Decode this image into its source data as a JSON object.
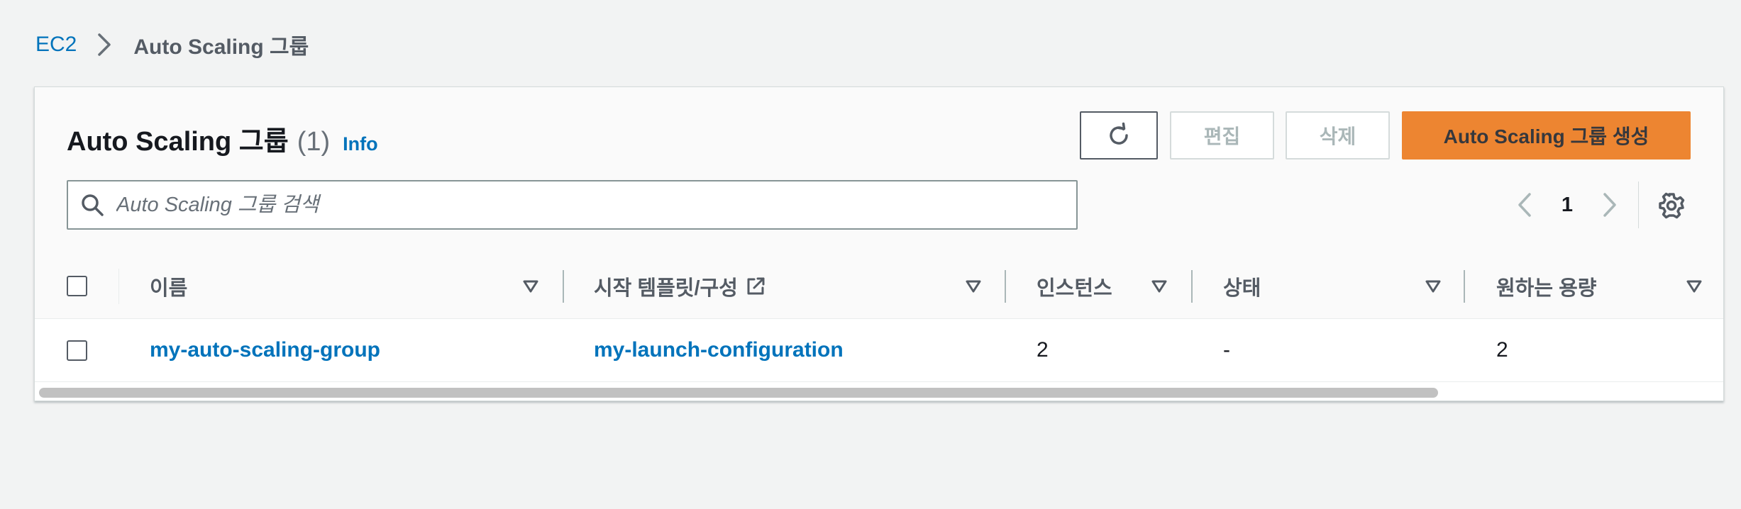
{
  "breadcrumb": {
    "root": "EC2",
    "current": "Auto Scaling 그룹"
  },
  "panel": {
    "title": "Auto Scaling 그룹",
    "count": "(1)",
    "info": "Info"
  },
  "toolbar": {
    "edit_label": "편집",
    "delete_label": "삭제",
    "create_label": "Auto Scaling 그룹 생성",
    "refresh_icon": "refresh-icon"
  },
  "search": {
    "placeholder": "Auto Scaling 그룹 검색",
    "value": ""
  },
  "pagination": {
    "current_page": "1"
  },
  "table": {
    "columns": [
      {
        "label": "이름"
      },
      {
        "label": "시작 템플릿/구성"
      },
      {
        "label": "인스턴스"
      },
      {
        "label": "상태"
      },
      {
        "label": "원하는 용량"
      }
    ],
    "rows": [
      {
        "name": "my-auto-scaling-group",
        "launch_config": "my-launch-configuration",
        "instances": "2",
        "status": "-",
        "desired_capacity": "2"
      }
    ]
  },
  "colors": {
    "link": "#0073bb",
    "primary_button": "#ec7211",
    "background": "#f2f3f3"
  }
}
